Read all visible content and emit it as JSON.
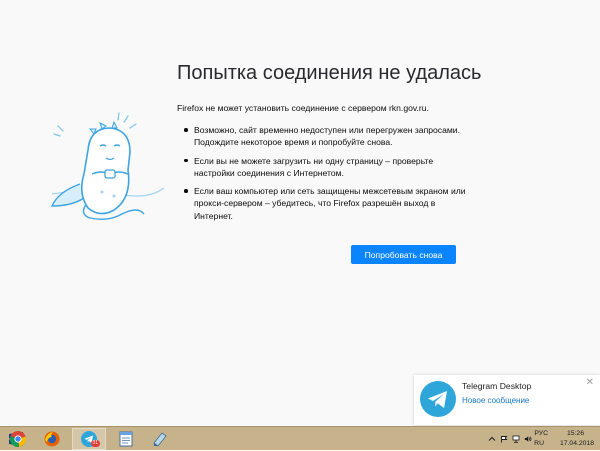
{
  "error_page": {
    "title": "Попытка соединения не удалась",
    "intro": "Firefox не может установить соединение с сервером rkn.gov.ru.",
    "bullets": [
      "Возможно, сайт временно недоступен или перегружен запросами. Подождите некоторое время и попробуйте снова.",
      "Если вы не можете загрузить ни одну страницу – проверьте настройки соединения с Интернетом.",
      "Если ваш компьютер или сеть защищены межсетевым экраном или прокси-сервером – убедитесь, что Firefox разрешён выход в Интернет."
    ],
    "retry_label": "Попробовать снова",
    "accent_color": "#0a84ff"
  },
  "notification": {
    "app_name": "Telegram Desktop",
    "message": "Новое сообщение",
    "close_glyph": "✕",
    "icon": "telegram-icon"
  },
  "taskbar": {
    "apps": [
      {
        "name": "start-button",
        "icon": "windows-logo-icon"
      },
      {
        "name": "chrome",
        "icon": "chrome-icon"
      },
      {
        "name": "firefox",
        "icon": "firefox-icon"
      },
      {
        "name": "telegram",
        "icon": "telegram-icon",
        "badge": "31",
        "active": true
      },
      {
        "name": "notepad",
        "icon": "notepad-icon"
      },
      {
        "name": "paint",
        "icon": "paint-icon"
      }
    ],
    "tray": {
      "language_top": "РУС",
      "language_bottom": "RU",
      "time": "15:26",
      "date": "17.04.2018"
    },
    "color": "#c6b38c"
  }
}
